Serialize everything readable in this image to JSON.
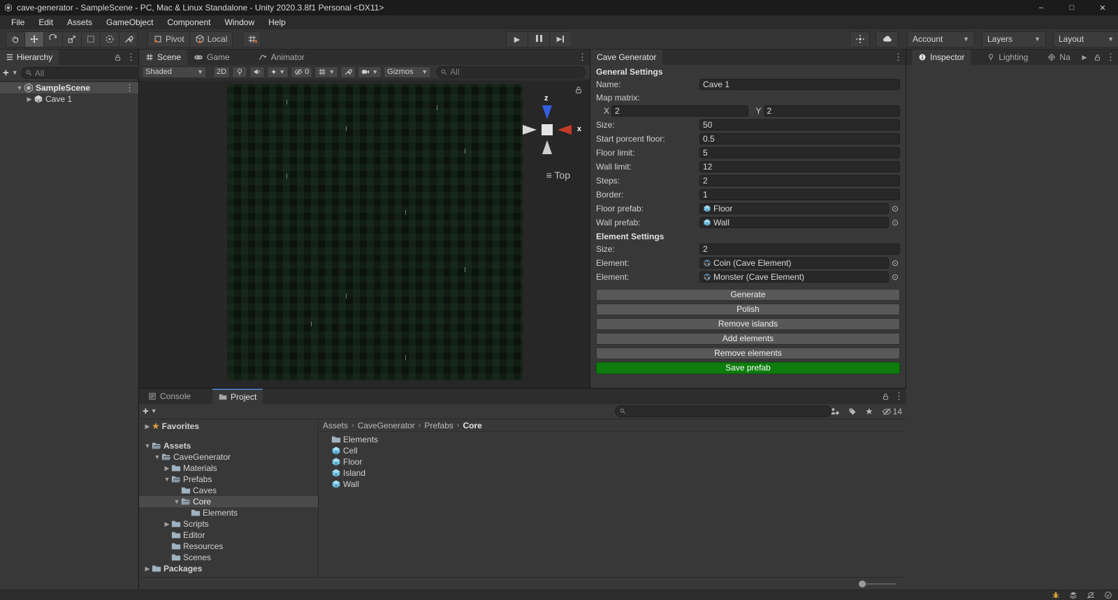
{
  "window": {
    "title": "cave-generator - SampleScene - PC, Mac & Linux Standalone - Unity 2020.3.8f1 Personal <DX11>",
    "minimize": "–",
    "maximize": "□",
    "close": "✕"
  },
  "menu": {
    "file": "File",
    "edit": "Edit",
    "assets": "Assets",
    "gameobject": "GameObject",
    "component": "Component",
    "window": "Window",
    "help": "Help"
  },
  "toolbar": {
    "pivot": "Pivot",
    "local": "Local",
    "account": "Account",
    "layers": "Layers",
    "layout": "Layout"
  },
  "hierarchy": {
    "tab": "Hierarchy",
    "search_placeholder": "All",
    "scene_row": "SampleScene",
    "cave_row": "Cave 1"
  },
  "scene": {
    "tab_scene": "Scene",
    "tab_game": "Game",
    "tab_animator": "Animator",
    "shaded": "Shaded",
    "two_d": "2D",
    "hidden_count": "0",
    "gizmos": "Gizmos",
    "search_placeholder": "All",
    "axis_z": "z",
    "axis_x": "x",
    "view_label": "Top"
  },
  "cave": {
    "tab": "Cave Generator",
    "general_header": "General Settings",
    "name_label": "Name:",
    "name_value": "Cave 1",
    "map_matrix_label": "Map matrix:",
    "x_label": "X",
    "x_value": "2",
    "y_label": "Y",
    "y_value": "2",
    "size_label": "Size:",
    "size_value": "50",
    "start_label": "Start porcent floor:",
    "start_value": "0.5",
    "floor_limit_label": "Floor limit:",
    "floor_limit_value": "5",
    "wall_limit_label": "Wall limit:",
    "wall_limit_value": "12",
    "steps_label": "Steps:",
    "steps_value": "2",
    "border_label": "Border:",
    "border_value": "1",
    "floor_prefab_label": "Floor prefab:",
    "floor_prefab_value": "Floor",
    "wall_prefab_label": "Wall prefab:",
    "wall_prefab_value": "Wall",
    "element_header": "Element Settings",
    "el_size_label": "Size:",
    "el_size_value": "2",
    "element1_label": "Element:",
    "element1_value": "Coin (Cave Element)",
    "element2_label": "Element:",
    "element2_value": "Monster (Cave Element)",
    "buttons": {
      "generate": "Generate",
      "polish": "Polish",
      "remove_islands": "Remove islands",
      "add_elements": "Add elements",
      "remove_elements": "Remove elements",
      "save_prefab": "Save prefab"
    }
  },
  "right_panel": {
    "inspector": "Inspector",
    "lighting": "Lighting",
    "navigation": "Na"
  },
  "project": {
    "tab_console": "Console",
    "tab_project": "Project",
    "search_placeholder": "",
    "hidden_count": "14",
    "tree": [
      {
        "label": "Favorites"
      },
      {
        "label": "Assets"
      },
      {
        "label": "CaveGenerator"
      },
      {
        "label": "Materials"
      },
      {
        "label": "Prefabs"
      },
      {
        "label": "Caves"
      },
      {
        "label": "Core"
      },
      {
        "label": "Elements"
      },
      {
        "label": "Scripts"
      },
      {
        "label": "Editor"
      },
      {
        "label": "Resources"
      },
      {
        "label": "Scenes"
      },
      {
        "label": "Packages"
      }
    ],
    "breadcrumb": {
      "b0": "Assets",
      "b1": "CaveGenerator",
      "b2": "Prefabs",
      "b3": "Core"
    },
    "items": [
      {
        "label": "Elements"
      },
      {
        "label": "Cell"
      },
      {
        "label": "Floor"
      },
      {
        "label": "Island"
      },
      {
        "label": "Wall"
      }
    ]
  },
  "colors": {
    "accent_blue": "#4876b2",
    "save_green": "#0c7d0c",
    "prefab_blue": "#6ec2e7",
    "folder_gray": "#9fb2c0",
    "star_gold": "#d9a33c",
    "selection_gray": "#4b4b4b",
    "axis_z_blue": "#355fe0",
    "axis_x_red": "#c43a26"
  }
}
